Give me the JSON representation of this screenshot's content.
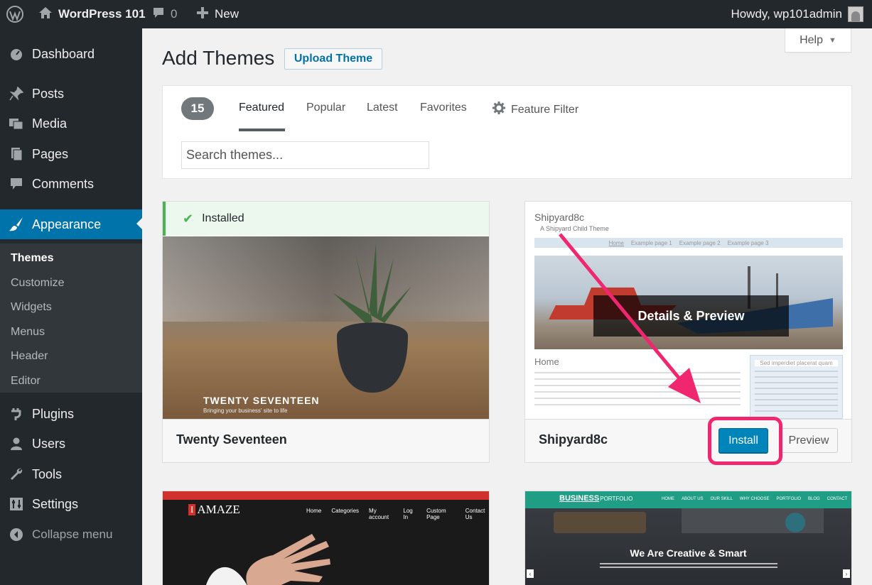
{
  "adminbar": {
    "site_name": "WordPress 101",
    "comments_count": "0",
    "new_label": "New",
    "howdy": "Howdy, wp101admin"
  },
  "sidebar": {
    "items": [
      {
        "label": "Dashboard",
        "icon": "dashboard-icon"
      },
      {
        "label": "Posts",
        "icon": "pin-icon"
      },
      {
        "label": "Media",
        "icon": "media-icon"
      },
      {
        "label": "Pages",
        "icon": "pages-icon"
      },
      {
        "label": "Comments",
        "icon": "comment-icon"
      },
      {
        "label": "Appearance",
        "icon": "brush-icon"
      },
      {
        "label": "Plugins",
        "icon": "plugin-icon"
      },
      {
        "label": "Users",
        "icon": "user-icon"
      },
      {
        "label": "Tools",
        "icon": "wrench-icon"
      },
      {
        "label": "Settings",
        "icon": "settings-icon"
      },
      {
        "label": "Collapse menu",
        "icon": "collapse-icon"
      }
    ],
    "submenu": [
      "Themes",
      "Customize",
      "Widgets",
      "Menus",
      "Header",
      "Editor"
    ]
  },
  "main": {
    "title": "Add Themes",
    "upload_label": "Upload Theme",
    "help_label": "Help",
    "count": "15",
    "tabs": [
      "Featured",
      "Popular",
      "Latest",
      "Favorites"
    ],
    "feature_filter": "Feature Filter",
    "search_placeholder": "Search themes..."
  },
  "themes": [
    {
      "name": "Twenty Seventeen",
      "installed_label": "Installed",
      "screenshot_title": "TWENTY SEVENTEEN",
      "screenshot_tagline": "Bringing your business' site to life"
    },
    {
      "name": "Shipyard8c",
      "install_label": "Install",
      "preview_label": "Preview",
      "overlay_label": "Details & Preview",
      "screenshot_title": "Shipyard8c",
      "screenshot_tagline": "A Shipyard Child Theme",
      "screenshot_heading": "Home",
      "screenshot_nav": [
        "Home",
        "Example page 1",
        "Example page 2",
        "Example page 3"
      ],
      "screenshot_side": "Sed imperdiet placerat quam"
    },
    {
      "name": "Amaze",
      "screenshot_logo": "AMAZE",
      "screenshot_nav": [
        "Home",
        "Categories",
        "My account",
        "Log In",
        "Custom Page",
        "Contact Us"
      ]
    },
    {
      "name": "Business Portfolio",
      "screenshot_logo_main": "BUSINESS",
      "screenshot_logo_sub": "PORTFOLIO",
      "screenshot_heading": "We Are Creative & Smart",
      "screenshot_nav": [
        "HOME",
        "ABOUT US",
        "OUR SKILL",
        "WHY CHOOSE",
        "PORTFOLIO",
        "BLOG",
        "CONTACT"
      ]
    }
  ],
  "colors": {
    "accent": "#0073aa",
    "annotation": "#f0266f",
    "install": "#0085ba"
  }
}
